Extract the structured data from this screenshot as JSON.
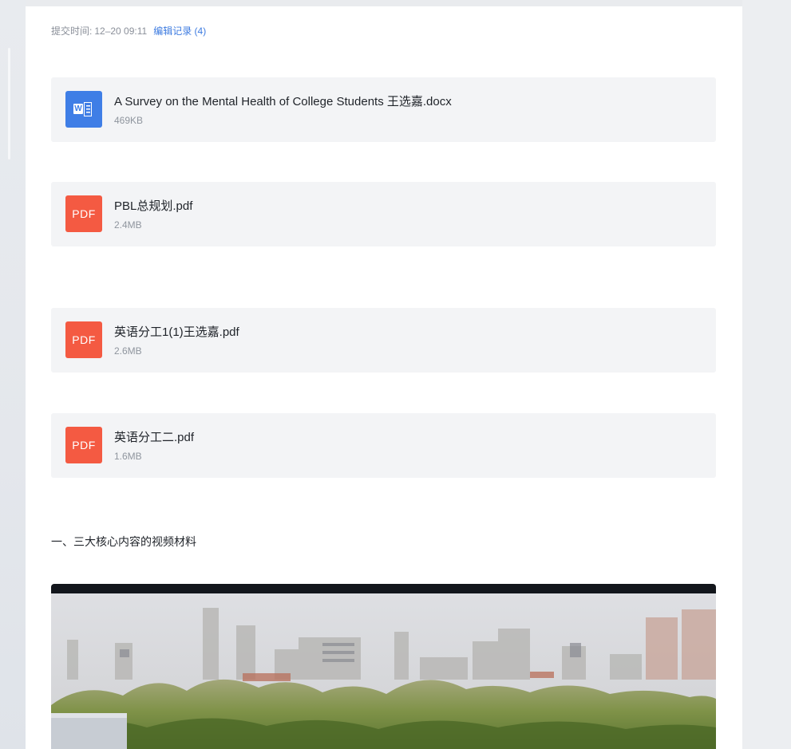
{
  "submission": {
    "label": "提交时间:",
    "time": "12–20 09:11",
    "edit_history_link": "编辑记录 (4)"
  },
  "files": [
    {
      "name": "A Survey on the Mental Health of College Students 王选嘉.docx",
      "size": "469KB",
      "type": "word",
      "icon": "word-doc-icon",
      "icon_label": "W"
    },
    {
      "name": "PBL总规划.pdf",
      "size": "2.4MB",
      "type": "pdf",
      "icon": "pdf-icon",
      "icon_label": "PDF"
    },
    {
      "name": "英语分工1(1)王选嘉.pdf",
      "size": "2.6MB",
      "type": "pdf",
      "icon": "pdf-icon",
      "icon_label": "PDF"
    },
    {
      "name": "英语分工二.pdf",
      "size": "1.6MB",
      "type": "pdf",
      "icon": "pdf-icon",
      "icon_label": "PDF"
    }
  ],
  "section_heading": "一、三大核心内容的视频材料",
  "colors": {
    "accent_link": "#3d7be0",
    "pdf_icon": "#f45a42",
    "word_icon": "#3f7ee6",
    "file_card_bg": "#f3f4f6",
    "video_top_bar": "#13161c"
  }
}
